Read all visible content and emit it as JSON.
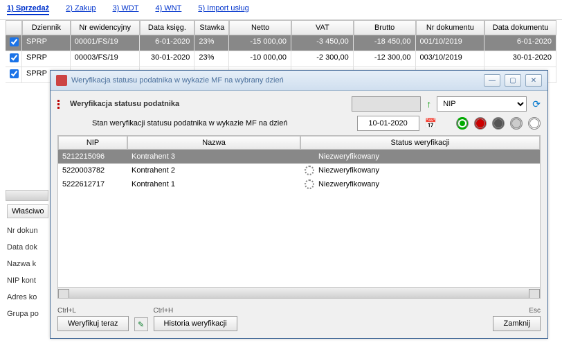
{
  "tabs": [
    {
      "label": "1) Sprzedaż",
      "active": true
    },
    {
      "label": "2) Zakup"
    },
    {
      "label": "3) WDT"
    },
    {
      "label": "4) WNT"
    },
    {
      "label": "5) Import usług"
    }
  ],
  "grid": {
    "headers": {
      "dziennik": "Dziennik",
      "nrew": "Nr ewidencyjny",
      "dataks": "Data księg.",
      "stawka": "Stawka",
      "netto": "Netto",
      "vat": "VAT",
      "brutto": "Brutto",
      "nrdok": "Nr dokumentu",
      "datadok": "Data dokumentu"
    },
    "rows": [
      {
        "dz": "SPRP",
        "nrew": "00001/FS/19",
        "dk": "6-01-2020",
        "st": "23%",
        "net": "-15 000,00",
        "vat": "-3 450,00",
        "br": "-18 450,00",
        "nrd": "001/10/2019",
        "dd": "6-01-2020",
        "sel": true
      },
      {
        "dz": "SPRP",
        "nrew": "00003/FS/19",
        "dk": "30-01-2020",
        "st": "23%",
        "net": "-10 000,00",
        "vat": "-2 300,00",
        "br": "-12 300,00",
        "nrd": "003/10/2019",
        "dd": "30-01-2020"
      },
      {
        "dz": "SPRP"
      }
    ]
  },
  "leftPanel": {
    "tab": "Właściwo",
    "rows": [
      "Nr dokun",
      "Data dok",
      "Nazwa k",
      "NIP kont",
      "Adres ko",
      "Grupa po"
    ]
  },
  "dialog": {
    "title": "Weryfikacja statusu podatnika w wykazie MF na wybrany dzień",
    "heading": "Weryfikacja statusu podatnika",
    "filterType": "NIP",
    "row2Label": "Stan weryfikacji statusu podatnika w wykazie MF na dzień",
    "date": "10-01-2020",
    "innerHeaders": {
      "nip": "NIP",
      "nazwa": "Nazwa",
      "status": "Status weryfikacji"
    },
    "innerRows": [
      {
        "nip": "5212215096",
        "nazwa": "Kontrahent 3",
        "status": "Niezweryfikowany",
        "sel": true
      },
      {
        "nip": "5220003782",
        "nazwa": "Kontrahent 2",
        "status": "Niezweryfikowany"
      },
      {
        "nip": "5222612717",
        "nazwa": "Kontrahent 1",
        "status": "Niezweryfikowany"
      }
    ],
    "footer": {
      "verifyHint": "Ctrl+L",
      "verify": "Weryfikuj teraz",
      "historyHint": "Ctrl+H",
      "history": "Historia weryfikacji",
      "closeHint": "Esc",
      "close": "Zamknij"
    }
  }
}
